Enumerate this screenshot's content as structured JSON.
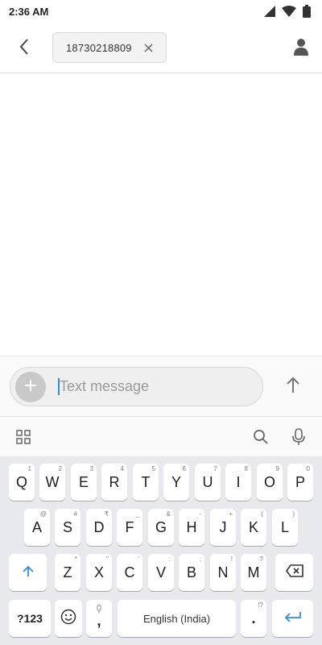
{
  "status_bar": {
    "time": "2:36 AM",
    "icons": [
      "signal-icon",
      "wifi-icon",
      "battery-icon"
    ]
  },
  "header": {
    "back_icon": "chevron-left-icon",
    "recipient": "18730218809",
    "remove_icon": "close-icon",
    "contact_icon": "person-icon"
  },
  "compose": {
    "attach_icon": "plus-icon",
    "placeholder": "Text message",
    "send_icon": "arrow-up-icon"
  },
  "keyboard_toolbar": {
    "left_icon": "grid-icon",
    "search_icon": "search-icon",
    "mic_icon": "microphone-icon"
  },
  "keyboard": {
    "row1": [
      {
        "label": "Q",
        "hint": "1"
      },
      {
        "label": "W",
        "hint": "2"
      },
      {
        "label": "E",
        "hint": "3"
      },
      {
        "label": "R",
        "hint": "4"
      },
      {
        "label": "T",
        "hint": "5"
      },
      {
        "label": "Y",
        "hint": "6"
      },
      {
        "label": "U",
        "hint": "7"
      },
      {
        "label": "I",
        "hint": "8"
      },
      {
        "label": "O",
        "hint": "9"
      },
      {
        "label": "P",
        "hint": "0"
      }
    ],
    "row2": [
      {
        "label": "A",
        "hint": "@"
      },
      {
        "label": "S",
        "hint": "#"
      },
      {
        "label": "D",
        "hint": "₹"
      },
      {
        "label": "F",
        "hint": "_"
      },
      {
        "label": "G",
        "hint": "&"
      },
      {
        "label": "H",
        "hint": "-"
      },
      {
        "label": "J",
        "hint": "+"
      },
      {
        "label": "K",
        "hint": "("
      },
      {
        "label": "L",
        "hint": ")"
      }
    ],
    "row3": [
      {
        "label": "Z",
        "hint": "*"
      },
      {
        "label": "X",
        "hint": "\""
      },
      {
        "label": "C",
        "hint": "'"
      },
      {
        "label": "V",
        "hint": ":"
      },
      {
        "label": "B",
        "hint": ";"
      },
      {
        "label": "N",
        "hint": "!"
      },
      {
        "label": "M",
        "hint": "?"
      }
    ],
    "shift_icon": "shift-arrow-icon",
    "backspace_icon": "backspace-icon",
    "symbols_label": "?123",
    "emoji_icon": "emoji-icon",
    "comma_label": ",",
    "space_label": "English (India)",
    "period_label": ".",
    "period_hint": "!?",
    "enter_icon": "enter-icon",
    "accent_color": "#2f8fd8"
  }
}
